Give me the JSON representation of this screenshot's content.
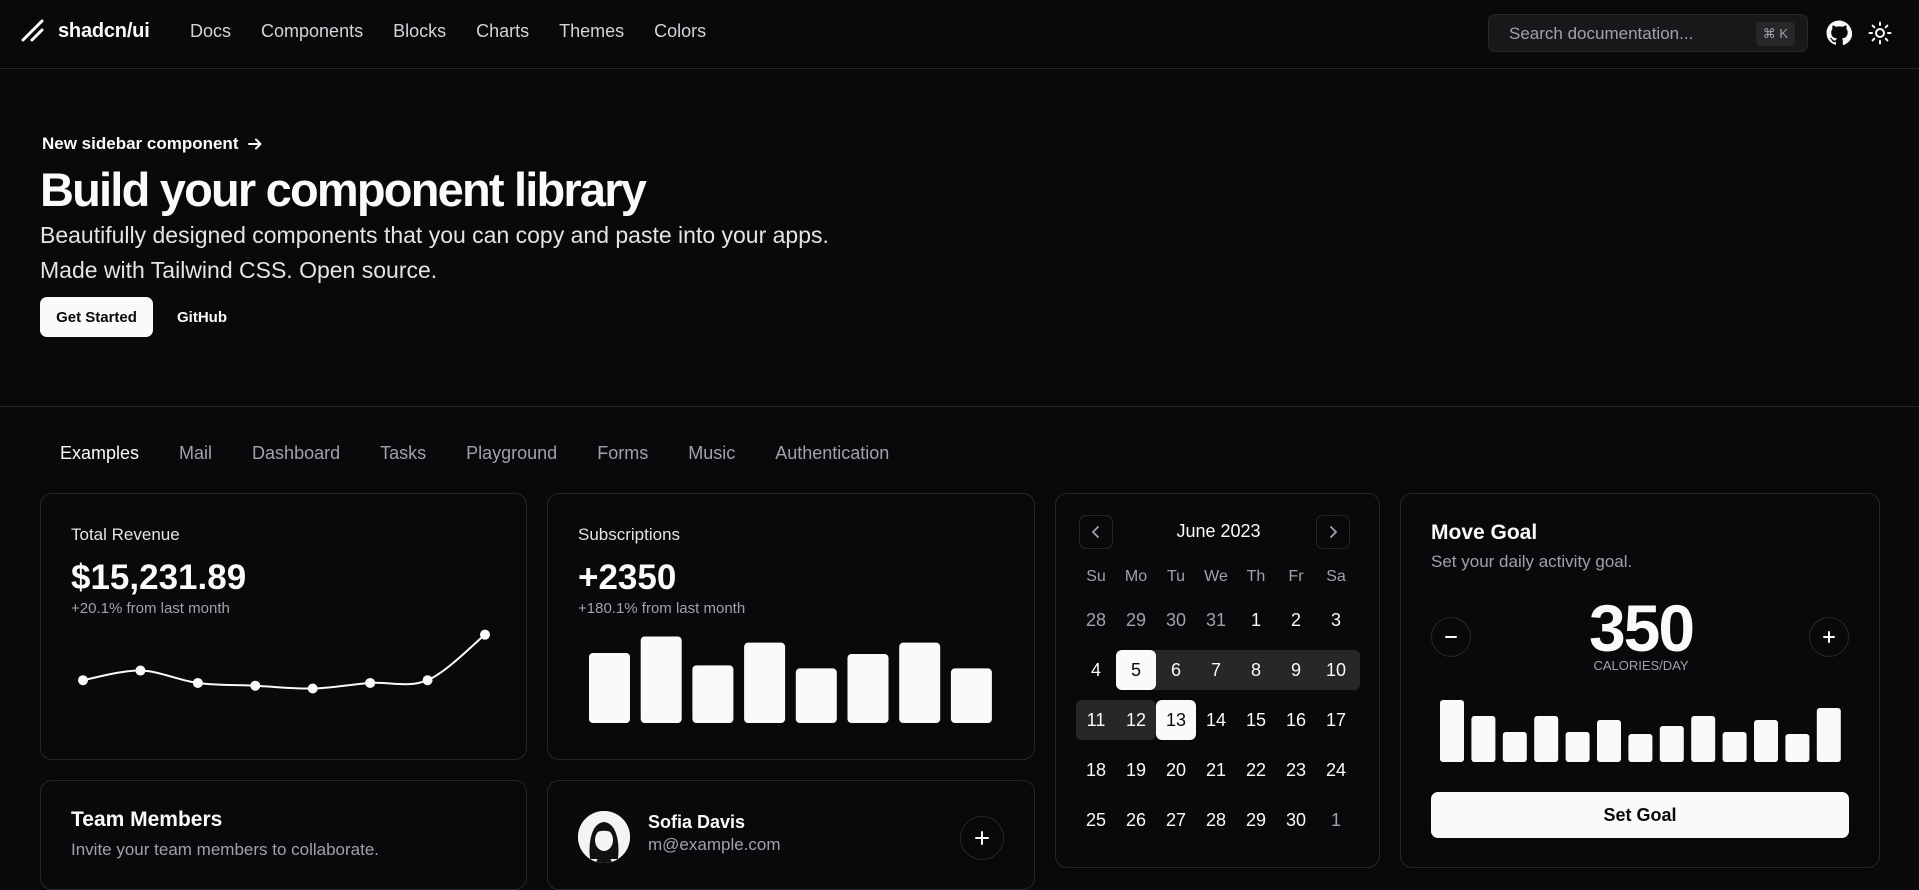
{
  "header": {
    "brand": "shadcn/ui",
    "nav": [
      "Docs",
      "Components",
      "Blocks",
      "Charts",
      "Themes",
      "Colors"
    ],
    "search_placeholder": "Search documentation...",
    "search_shortcut": "⌘ K"
  },
  "hero": {
    "announcement": "New sidebar component",
    "title": "Build your component library",
    "subtitle_line1": "Beautifully designed components that you can copy and paste into your apps.",
    "subtitle_line2": "Made with Tailwind CSS. Open source.",
    "primary_button": "Get Started",
    "secondary_button": "GitHub"
  },
  "tabs": [
    "Examples",
    "Mail",
    "Dashboard",
    "Tasks",
    "Playground",
    "Forms",
    "Music",
    "Authentication"
  ],
  "revenue": {
    "label": "Total Revenue",
    "value": "$15,231.89",
    "change": "+20.1% from last month"
  },
  "subscriptions": {
    "label": "Subscriptions",
    "value": "+2350",
    "change": "+180.1% from last month"
  },
  "team": {
    "title": "Team Members",
    "description": "Invite your team members to collaborate."
  },
  "member": {
    "name": "Sofia Davis",
    "email": "m@example.com"
  },
  "calendar": {
    "title": "June 2023",
    "weekdays": [
      "Su",
      "Mo",
      "Tu",
      "We",
      "Th",
      "Fr",
      "Sa"
    ],
    "weeks": [
      [
        "28",
        "29",
        "30",
        "31",
        "1",
        "2",
        "3"
      ],
      [
        "4",
        "5",
        "6",
        "7",
        "8",
        "9",
        "10"
      ],
      [
        "11",
        "12",
        "13",
        "14",
        "15",
        "16",
        "17"
      ],
      [
        "18",
        "19",
        "20",
        "21",
        "22",
        "23",
        "24"
      ],
      [
        "25",
        "26",
        "27",
        "28",
        "29",
        "30",
        "1"
      ]
    ],
    "range_start": "5",
    "range_end": "13"
  },
  "goal": {
    "title": "Move Goal",
    "description": "Set your daily activity goal.",
    "value": "350",
    "unit": "CALORIES/DAY",
    "button": "Set Goal"
  },
  "chart_data": [
    {
      "type": "line",
      "x": [
        1,
        2,
        3,
        4,
        5,
        6,
        7,
        8
      ],
      "values": [
        35,
        42,
        33,
        31,
        29,
        33,
        35,
        68
      ],
      "grid": false,
      "legend": "none"
    },
    {
      "type": "bar",
      "x": [
        1,
        2,
        3,
        4,
        5,
        6,
        7,
        8
      ],
      "values": [
        68,
        84,
        56,
        78,
        53,
        67,
        78,
        53
      ],
      "grid": false,
      "legend": "none"
    },
    {
      "type": "bar",
      "x": [
        1,
        2,
        3,
        4,
        5,
        6,
        7,
        8,
        9,
        10,
        11,
        12,
        13
      ],
      "values": [
        62,
        46,
        30,
        46,
        30,
        42,
        28,
        36,
        46,
        30,
        42,
        28,
        54
      ],
      "grid": false,
      "legend": "none"
    }
  ]
}
